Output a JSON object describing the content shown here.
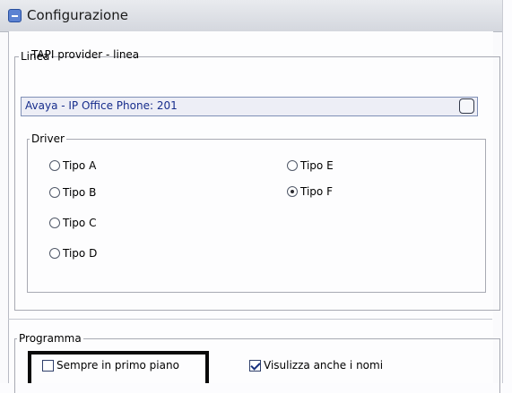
{
  "window": {
    "title": "Configurazione"
  },
  "linea": {
    "legend": "Linea",
    "tapi_label": "TAPI provider - linea",
    "tapi_value": "Avaya - IP Office Phone: 201"
  },
  "driver": {
    "legend": "Driver",
    "options": [
      {
        "label": "Tipo A",
        "checked": false
      },
      {
        "label": "Tipo B",
        "checked": false
      },
      {
        "label": "Tipo C",
        "checked": false
      },
      {
        "label": "Tipo D",
        "checked": false
      },
      {
        "label": "Tipo E",
        "checked": false
      },
      {
        "label": "Tipo F",
        "checked": true
      }
    ]
  },
  "programma": {
    "legend": "Programma",
    "always_on_top": {
      "label": "Sempre in primo piano",
      "checked": false
    },
    "show_names": {
      "label": "Visulizza anche i nomi",
      "checked": true
    }
  }
}
